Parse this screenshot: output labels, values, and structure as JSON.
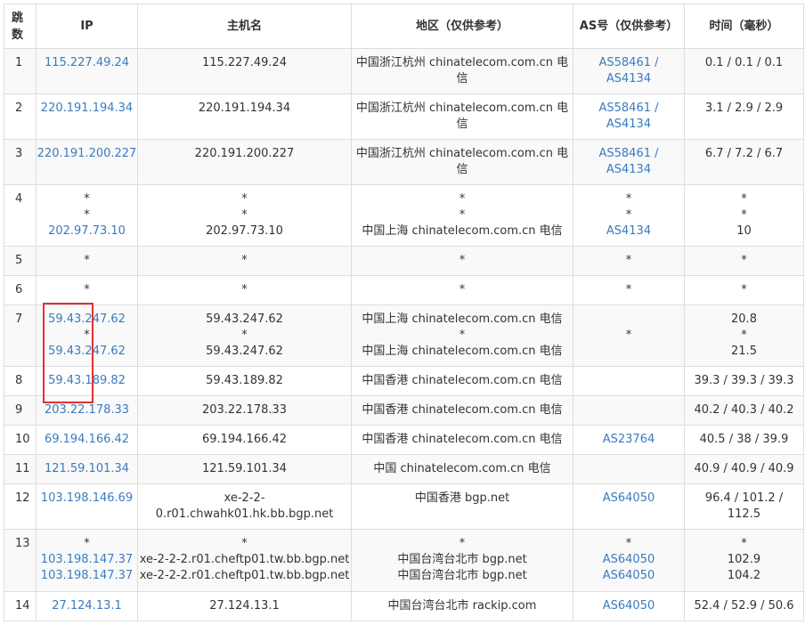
{
  "headers": {
    "hop": "跳数",
    "ip": "IP",
    "host": "主机名",
    "region": "地区（仅供参考）",
    "as": "AS号（仅供参考）",
    "time": "时间（毫秒）"
  },
  "rows": [
    {
      "hop": "1",
      "ip": [
        "115.227.49.24"
      ],
      "host": [
        "115.227.49.24"
      ],
      "region": [
        "中国浙江杭州 chinatelecom.com.cn 电",
        "信"
      ],
      "as": [
        "AS58461 /",
        "AS4134"
      ],
      "time": [
        "0.1 / 0.1 / 0.1"
      ]
    },
    {
      "hop": "2",
      "ip": [
        "220.191.194.34"
      ],
      "host": [
        "220.191.194.34"
      ],
      "region": [
        "中国浙江杭州 chinatelecom.com.cn 电",
        "信"
      ],
      "as": [
        "AS58461 /",
        "AS4134"
      ],
      "time": [
        "3.1 / 2.9 / 2.9"
      ]
    },
    {
      "hop": "3",
      "ip": [
        "220.191.200.227"
      ],
      "host": [
        "220.191.200.227"
      ],
      "region": [
        "中国浙江杭州 chinatelecom.com.cn 电",
        "信"
      ],
      "as": [
        "AS58461 /",
        "AS4134"
      ],
      "time": [
        "6.7 / 7.2 / 6.7"
      ]
    },
    {
      "hop": "4",
      "ip": [
        "*",
        "*",
        "202.97.73.10"
      ],
      "host": [
        "*",
        "*",
        "202.97.73.10"
      ],
      "region": [
        "*",
        "*",
        "中国上海 chinatelecom.com.cn 电信"
      ],
      "as": [
        "*",
        "*",
        "AS4134"
      ],
      "time": [
        "*",
        "*",
        "10"
      ]
    },
    {
      "hop": "5",
      "ip": [
        "*"
      ],
      "host": [
        "*"
      ],
      "region": [
        "*"
      ],
      "as": [
        "*"
      ],
      "time": [
        "*"
      ]
    },
    {
      "hop": "6",
      "ip": [
        "*"
      ],
      "host": [
        "*"
      ],
      "region": [
        "*"
      ],
      "as": [
        "*"
      ],
      "time": [
        "*"
      ]
    },
    {
      "hop": "7",
      "ip": [
        "59.43.247.62",
        "*",
        "59.43.247.62"
      ],
      "host": [
        "59.43.247.62",
        "*",
        "59.43.247.62"
      ],
      "region": [
        "中国上海 chinatelecom.com.cn 电信",
        "*",
        "中国上海 chinatelecom.com.cn 电信"
      ],
      "as": [
        "",
        "*",
        ""
      ],
      "time": [
        "20.8",
        "*",
        "21.5"
      ]
    },
    {
      "hop": "8",
      "ip": [
        "59.43.189.82"
      ],
      "host": [
        "59.43.189.82"
      ],
      "region": [
        "中国香港 chinatelecom.com.cn 电信"
      ],
      "as": [
        ""
      ],
      "time": [
        "39.3 / 39.3 / 39.3"
      ]
    },
    {
      "hop": "9",
      "ip": [
        "203.22.178.33"
      ],
      "host": [
        "203.22.178.33"
      ],
      "region": [
        "中国香港 chinatelecom.com.cn 电信"
      ],
      "as": [
        ""
      ],
      "time": [
        "40.2 / 40.3 / 40.2"
      ]
    },
    {
      "hop": "10",
      "ip": [
        "69.194.166.42"
      ],
      "host": [
        "69.194.166.42"
      ],
      "region": [
        "中国香港 chinatelecom.com.cn 电信"
      ],
      "as": [
        "AS23764"
      ],
      "time": [
        "40.5 / 38 / 39.9"
      ]
    },
    {
      "hop": "11",
      "ip": [
        "121.59.101.34"
      ],
      "host": [
        "121.59.101.34"
      ],
      "region": [
        "中国 chinatelecom.com.cn 电信"
      ],
      "as": [
        ""
      ],
      "time": [
        "40.9 / 40.9 / 40.9"
      ]
    },
    {
      "hop": "12",
      "ip": [
        "103.198.146.69"
      ],
      "host": [
        "xe-2-2-",
        "0.r01.chwahk01.hk.bb.bgp.net"
      ],
      "region": [
        "中国香港 bgp.net"
      ],
      "as": [
        "AS64050"
      ],
      "time": [
        "96.4 / 101.2 /",
        "112.5"
      ]
    },
    {
      "hop": "13",
      "ip": [
        "*",
        "103.198.147.37",
        "103.198.147.37"
      ],
      "host": [
        "*",
        "xe-2-2-2.r01.cheftp01.tw.bb.bgp.net",
        "xe-2-2-2.r01.cheftp01.tw.bb.bgp.net"
      ],
      "region": [
        "*",
        "中国台湾台北市 bgp.net",
        "中国台湾台北市 bgp.net"
      ],
      "as": [
        "*",
        "AS64050",
        "AS64050"
      ],
      "time": [
        "*",
        "102.9",
        "104.2"
      ]
    },
    {
      "hop": "14",
      "ip": [
        "27.124.13.1"
      ],
      "host": [
        "27.124.13.1"
      ],
      "region": [
        "中国台湾台北市 rackip.com"
      ],
      "as": [
        "AS64050"
      ],
      "time": [
        "52.4 / 52.9 / 50.6"
      ]
    }
  ],
  "link_color": "#3a7bbf",
  "highlight_color": "#e0312f"
}
